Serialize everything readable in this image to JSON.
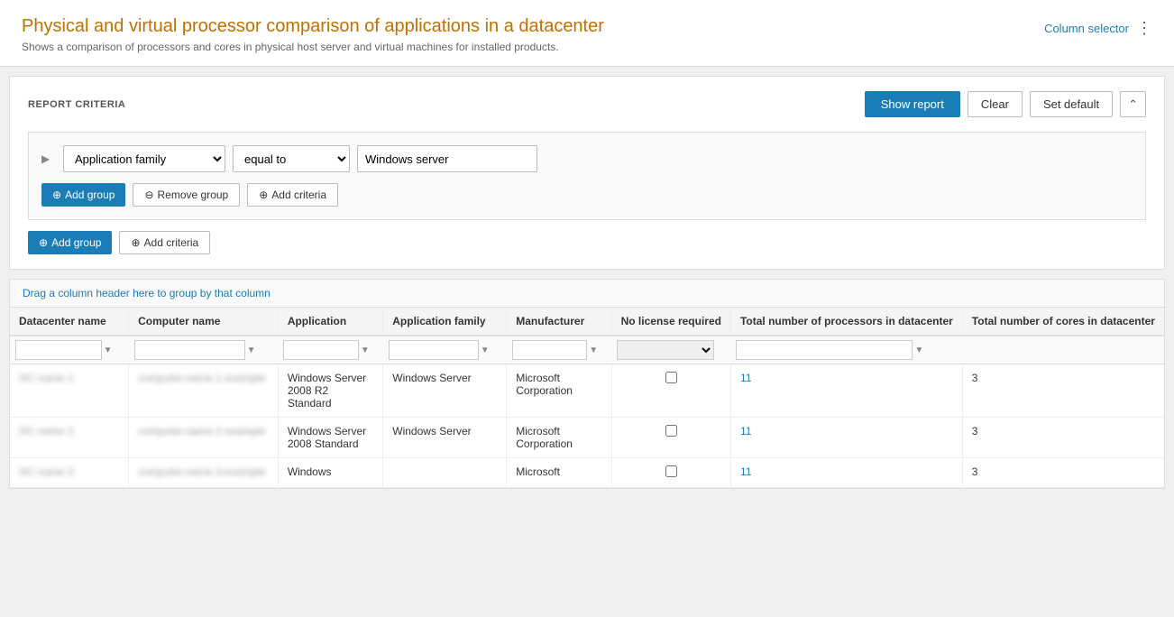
{
  "header": {
    "title": "Physical and virtual processor comparison of applications in a datacenter",
    "subtitle": "Shows a comparison of processors and cores in physical host server and virtual machines for installed products.",
    "column_selector": "Column selector",
    "dots": "⋮"
  },
  "criteria": {
    "section_title": "REPORT CRITERIA",
    "show_report": "Show report",
    "clear": "Clear",
    "set_default": "Set default",
    "collapse_icon": "⌃",
    "group": {
      "field_value": "Application family",
      "operator_value": "equal to",
      "criteria_value": "Windows server",
      "add_group": "Add group",
      "remove_group": "Remove group",
      "add_criteria": "Add criteria"
    },
    "outer": {
      "add_group": "Add group",
      "add_criteria": "Add criteria"
    }
  },
  "drag_hint": "Drag a column header here to group by that column",
  "table": {
    "columns": [
      "Datacenter name",
      "Computer name",
      "Application",
      "Application family",
      "Manufacturer",
      "No license required",
      "Total number of processors in datacenter",
      "Total number of cores in datacenter"
    ],
    "rows": [
      {
        "datacenter": "blurred1",
        "computer": "blurred2",
        "application": "Windows Server 2008 R2 Standard",
        "app_family": "Windows Server",
        "manufacturer": "Microsoft Corporation",
        "no_license": false,
        "processors": "11",
        "cores": "3"
      },
      {
        "datacenter": "blurred3",
        "computer": "blurred4",
        "application": "Windows Server 2008 Standard",
        "app_family": "Windows Server",
        "manufacturer": "Microsoft Corporation",
        "no_license": false,
        "processors": "11",
        "cores": "3"
      },
      {
        "datacenter": "blurred5",
        "computer": "blurred6",
        "application": "Windows",
        "app_family": "",
        "manufacturer": "Microsoft",
        "no_license": false,
        "processors": "11",
        "cores": "3"
      }
    ]
  }
}
